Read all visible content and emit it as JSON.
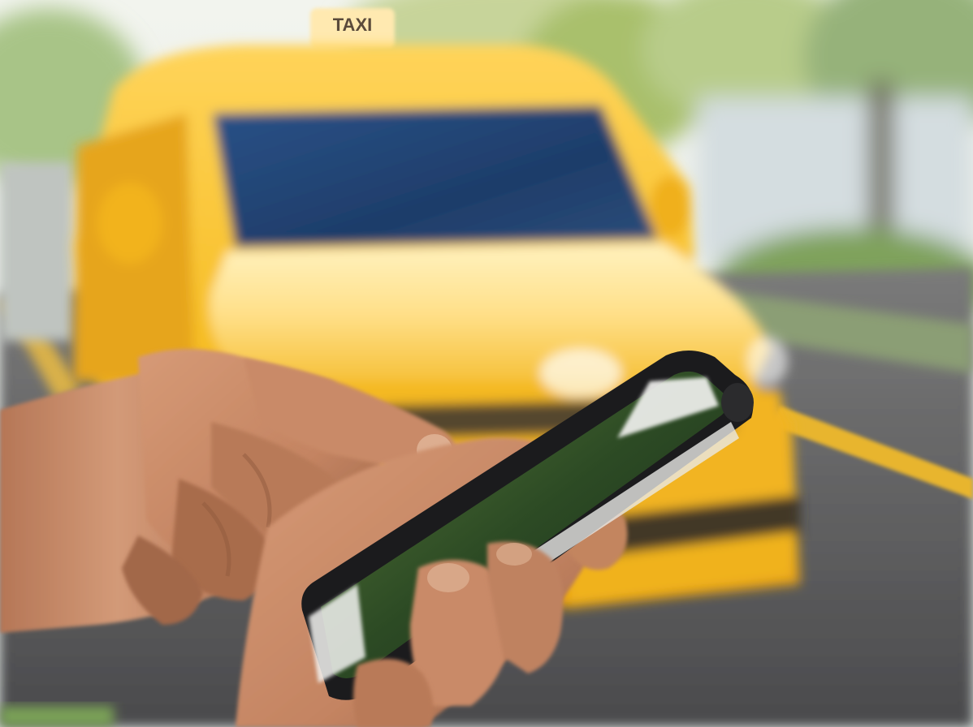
{
  "photo": {
    "taxi_sign_text": "TAXI",
    "colors": {
      "taxi_yellow": "#f4b81c",
      "taxi_yellow_light": "#ffd34d",
      "windshield": "#1f3f6e",
      "road": "#59585a",
      "road_line": "#e8b52f",
      "skin": "#c98a67",
      "skin_shadow": "#8f5a3e",
      "phone_body": "#1b1b1d",
      "phone_screen": "#2a4a2a",
      "foliage": "#8cb36a",
      "wall": "#d5dde0"
    }
  }
}
